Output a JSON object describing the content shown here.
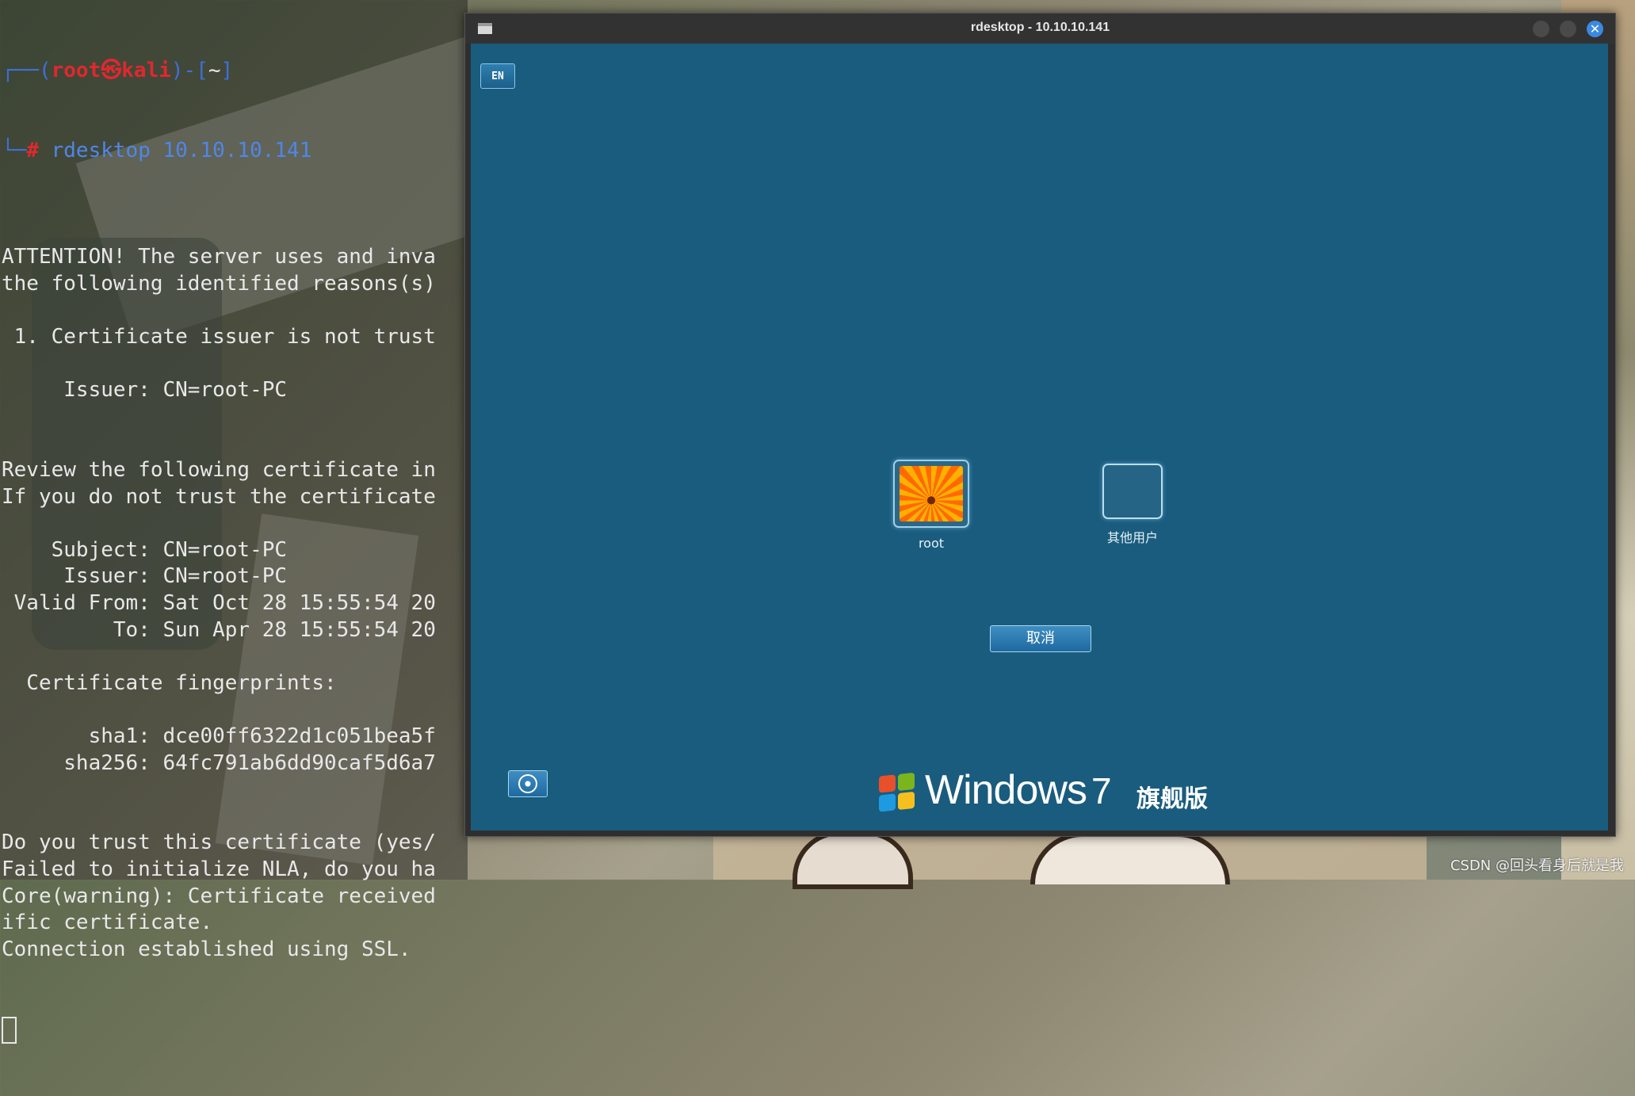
{
  "terminal": {
    "prompt_user": "root",
    "prompt_at": "㉿",
    "prompt_host": "kali",
    "prompt_dir": "~",
    "command": "rdesktop 10.10.10.141",
    "lines": [
      "",
      "ATTENTION! The server uses and inva",
      "the following identified reasons(s)",
      "",
      " 1. Certificate issuer is not trust",
      "",
      "     Issuer: CN=root-PC",
      "",
      "",
      "Review the following certificate in",
      "If you do not trust the certificate",
      "",
      "    Subject: CN=root-PC",
      "     Issuer: CN=root-PC",
      " Valid From: Sat Oct 28 15:55:54 20",
      "         To: Sun Apr 28 15:55:54 20",
      "",
      "  Certificate fingerprints:",
      "",
      "       sha1: dce00ff6322d1c051bea5f",
      "     sha256: 64fc791ab6dd90caf5d6a7",
      "",
      "",
      "Do you trust this certificate (yes/",
      "Failed to initialize NLA, do you ha",
      "Core(warning): Certificate received",
      "ific certificate.",
      "Connection established using SSL."
    ]
  },
  "rdesktop": {
    "title": "rdesktop - 10.10.10.141",
    "close_glyph": "✕",
    "lang_indicator": "EN",
    "users": [
      {
        "label": "root"
      },
      {
        "label": "其他用户"
      }
    ],
    "cancel_label": "取消",
    "brand_word": "Windows",
    "brand_version": "7",
    "brand_edition": "旗舰版"
  },
  "watermark": "CSDN @回头看身后就是我"
}
